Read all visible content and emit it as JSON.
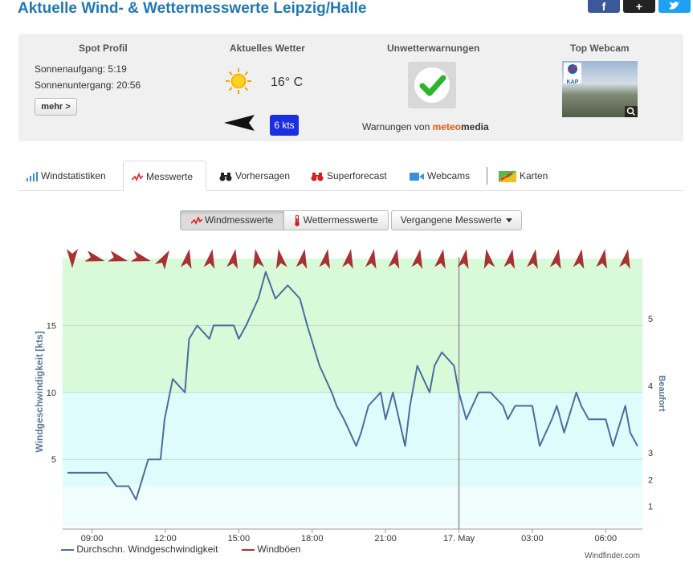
{
  "header": {
    "title": "Aktuelle Wind- & Wettermesswerte Leipzig/Halle"
  },
  "social": {
    "facebook": "f",
    "plus": "+",
    "twitter": "t"
  },
  "info": {
    "spot": {
      "title": "Spot Profil",
      "sunrise": "Sonnenaufgang: 5:19",
      "sunset": "Sonnenuntergang: 20:56",
      "more_label": "mehr >"
    },
    "weather": {
      "title": "Aktuelles Wetter",
      "temperature": "16° C",
      "wind_speed": "6 kts",
      "weather_icon": "sun-icon",
      "wind_icon": "wind-arrow-icon"
    },
    "warnings": {
      "title": "Unwetterwarnungen",
      "text_prefix": "Warnungen von",
      "provider_a": "meteo",
      "provider_b": "media",
      "status_icon": "checkmark-icon"
    },
    "webcam": {
      "title": "Top Webcam",
      "logo_text": "KAP"
    }
  },
  "tabs": [
    {
      "label": "Windstatistiken",
      "icon": "bar-chart-icon"
    },
    {
      "label": "Messwerte",
      "icon": "line-chart-icon"
    },
    {
      "label": "Vorhersagen",
      "icon": "binoculars-icon"
    },
    {
      "label": "Superforecast",
      "icon": "binoculars-red-icon"
    },
    {
      "label": "Webcams",
      "icon": "camera-icon"
    },
    {
      "label": "Karten",
      "icon": "map-icon"
    }
  ],
  "view_buttons": {
    "wind": "Windmesswerte",
    "weather": "Wettermesswerte",
    "past": "Vergangene Messwerte"
  },
  "chart_data": {
    "type": "line",
    "ylabel": "Windgeschwindigkeit [kts]",
    "ylabel_right": "Beaufort",
    "yticks": [
      5,
      10,
      15
    ],
    "ylim": [
      -0.2,
      20
    ],
    "beaufort_ticks": [
      {
        "label": "1",
        "kts": 1.5
      },
      {
        "label": "2",
        "kts": 3.5
      },
      {
        "label": "3",
        "kts": 5.5
      },
      {
        "label": "4",
        "kts": 10.5
      },
      {
        "label": "5",
        "kts": 15.5
      }
    ],
    "x_labels": [
      "09:00",
      "12:00",
      "15:00",
      "18:00",
      "21:00",
      "17. May",
      "03:00",
      "06:00"
    ],
    "x_label_hours": [
      9,
      12,
      15,
      18,
      21,
      24,
      27,
      30
    ],
    "xlim": [
      7.8,
      31.5
    ],
    "now_marker_hour": 24,
    "bands": [
      {
        "from": 0,
        "to": 3,
        "color": "#f0fdfd"
      },
      {
        "from": 3,
        "to": 10,
        "color": "#dffcfc"
      },
      {
        "from": 10,
        "to": 20,
        "color": "#d9fad9"
      }
    ],
    "grid": true,
    "series": [
      {
        "name": "Durchschn. Windgeschwindigkeit",
        "color": "#4a6e9e",
        "x": [
          8.0,
          9.0,
          9.3,
          9.6,
          10.0,
          10.2,
          10.5,
          10.8,
          11.3,
          11.8,
          11.97,
          12.3,
          12.8,
          12.97,
          13.3,
          13.8,
          13.97,
          14.3,
          14.8,
          15.0,
          15.3,
          15.8,
          16.1,
          16.5,
          17.0,
          17.5,
          17.8,
          18.3,
          18.8,
          19.0,
          19.3,
          19.8,
          20.0,
          20.3,
          20.8,
          21.0,
          21.3,
          21.8,
          22.0,
          22.3,
          22.8,
          23.0,
          23.3,
          23.8,
          24.0,
          24.3,
          24.8,
          25.0,
          25.3,
          25.8,
          26.0,
          26.3,
          26.8,
          27.0,
          27.3,
          27.8,
          28.0,
          28.3,
          28.8,
          29.0,
          29.3,
          29.8,
          30.0,
          30.3,
          30.8,
          31.0,
          31.3
        ],
        "y": [
          4,
          4,
          4,
          4,
          3,
          3,
          3,
          2,
          5,
          5,
          8,
          11,
          10,
          14,
          15,
          14,
          15,
          15,
          15,
          14,
          15,
          17,
          19,
          17,
          18,
          17,
          15,
          12,
          10,
          9,
          8,
          6,
          7,
          9,
          10,
          8,
          10,
          6,
          9,
          12,
          10,
          12,
          13,
          12,
          10,
          8,
          10,
          10,
          10,
          9,
          8,
          9,
          9,
          9,
          6,
          8,
          9,
          7,
          10,
          9,
          8,
          8,
          8,
          6,
          9,
          7,
          6
        ]
      },
      {
        "name": "Windböen",
        "color": "#b03030"
      }
    ],
    "direction_arrow_angles": [
      90,
      15,
      15,
      15,
      -60,
      -80,
      -80,
      -80,
      -100,
      -100,
      -80,
      -80,
      -80,
      -80,
      -80,
      -80,
      -80,
      -80,
      -100,
      -80,
      -80,
      -80,
      -80,
      -80,
      -80
    ]
  },
  "credit": "Windfinder.com"
}
